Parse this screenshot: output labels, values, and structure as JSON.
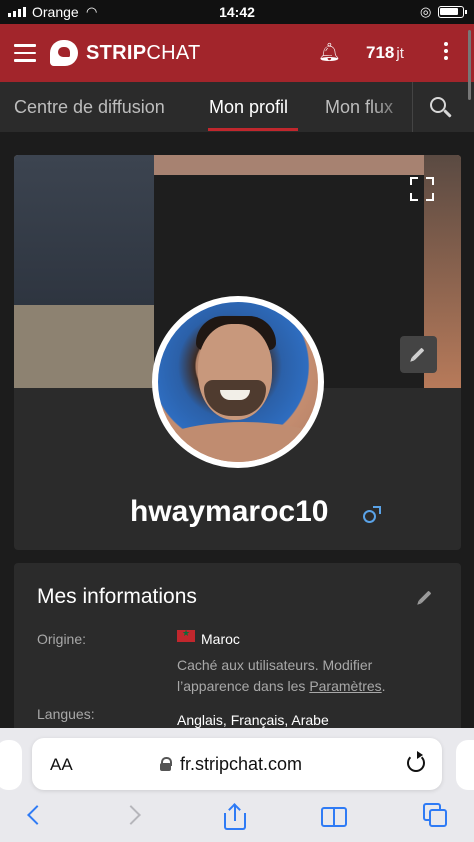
{
  "status_bar": {
    "carrier": "Orange",
    "time": "14:42"
  },
  "header": {
    "logo_bold": "STRIP",
    "logo_light": "CHAT",
    "tokens_value": "718",
    "tokens_unit": "jt"
  },
  "tabs": [
    {
      "label": "Centre de diffusion",
      "active": false
    },
    {
      "label": "Mon profil",
      "active": true
    },
    {
      "label": "Mon flux",
      "active": false
    }
  ],
  "profile": {
    "username": "hwaymaroc10",
    "gender_icon": "male-icon"
  },
  "info": {
    "title": "Mes informations",
    "origin_label": "Origine:",
    "origin_value": "Maroc",
    "hidden_note_before": "Caché aux utilisateurs. Modifier l’apparence dans les ",
    "hidden_note_link": "Paramètres",
    "hidden_note_after": ".",
    "languages_label": "Langues:",
    "languages_value": "Anglais, Français, Arabe"
  },
  "browser": {
    "text_size_label": "AA",
    "url": "fr.stripchat.com"
  },
  "colors": {
    "brand": "#a2252b",
    "accent_blue": "#2f7bf5",
    "male_icon": "#5aa3e8"
  }
}
